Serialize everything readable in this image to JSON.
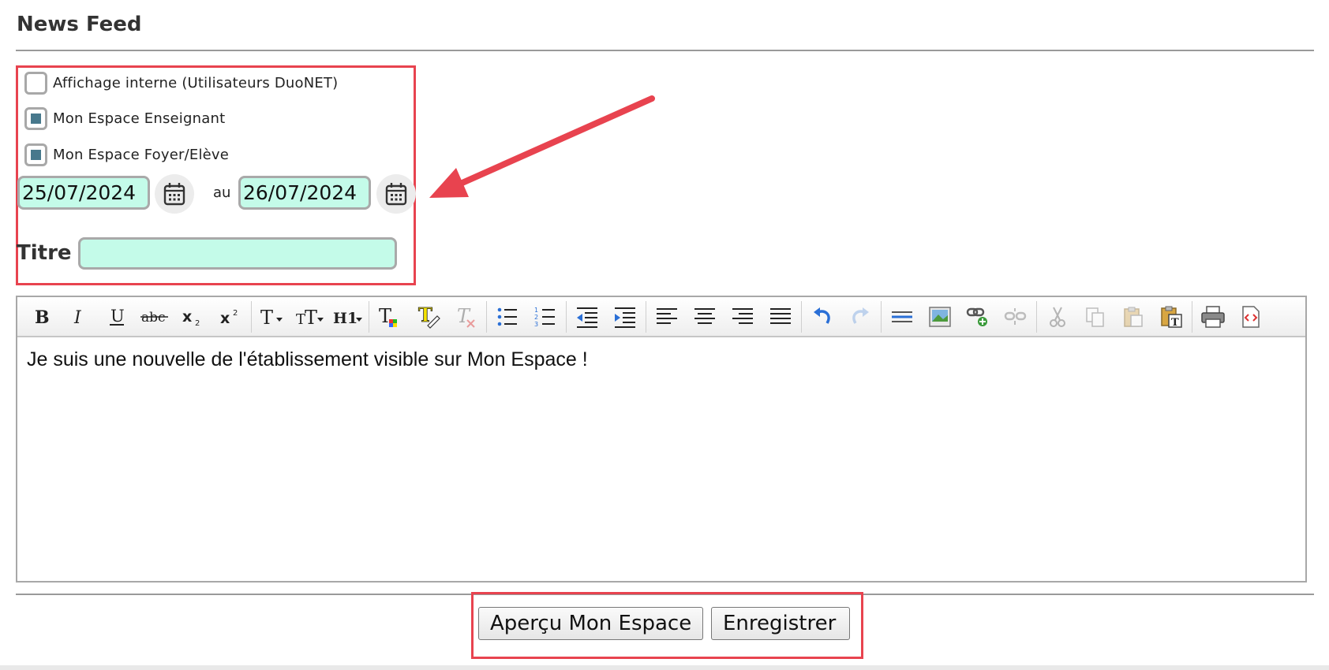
{
  "page": {
    "title": "News Feed"
  },
  "form": {
    "checkboxes": [
      {
        "label": "Affichage interne (Utilisateurs DuoNET)",
        "checked": false
      },
      {
        "label": "Mon Espace Enseignant",
        "checked": true
      },
      {
        "label": "Mon Espace Foyer/Elève",
        "checked": true
      }
    ],
    "date_from": "25/07/2024",
    "date_separator": "au",
    "date_to": "26/07/2024",
    "titre_label": "Titre",
    "titre_value": ""
  },
  "editor": {
    "content": "Je suis une nouvelle de l'établissement visible sur Mon Espace !",
    "toolbar_icons": [
      "bold-icon",
      "italic-icon",
      "underline-icon",
      "strikethrough-icon",
      "subscript-icon",
      "superscript-icon",
      "font-family-icon",
      "font-size-icon",
      "heading-icon",
      "text-color-icon",
      "highlight-icon",
      "clear-format-icon",
      "bullet-list-icon",
      "numbered-list-icon",
      "outdent-icon",
      "indent-icon",
      "align-left-icon",
      "align-center-icon",
      "align-right-icon",
      "justify-icon",
      "undo-icon",
      "redo-icon",
      "horizontal-rule-icon",
      "image-icon",
      "link-icon",
      "unlink-icon",
      "cut-icon",
      "copy-icon",
      "paste-icon",
      "paste-text-icon",
      "print-icon",
      "source-code-icon"
    ]
  },
  "actions": {
    "preview_label": "Aperçu Mon Espace",
    "save_label": "Enregistrer"
  },
  "colors": {
    "highlight": "#e8434f",
    "input_bg": "#c4fbe9",
    "checkbox_fill": "#47788c"
  }
}
